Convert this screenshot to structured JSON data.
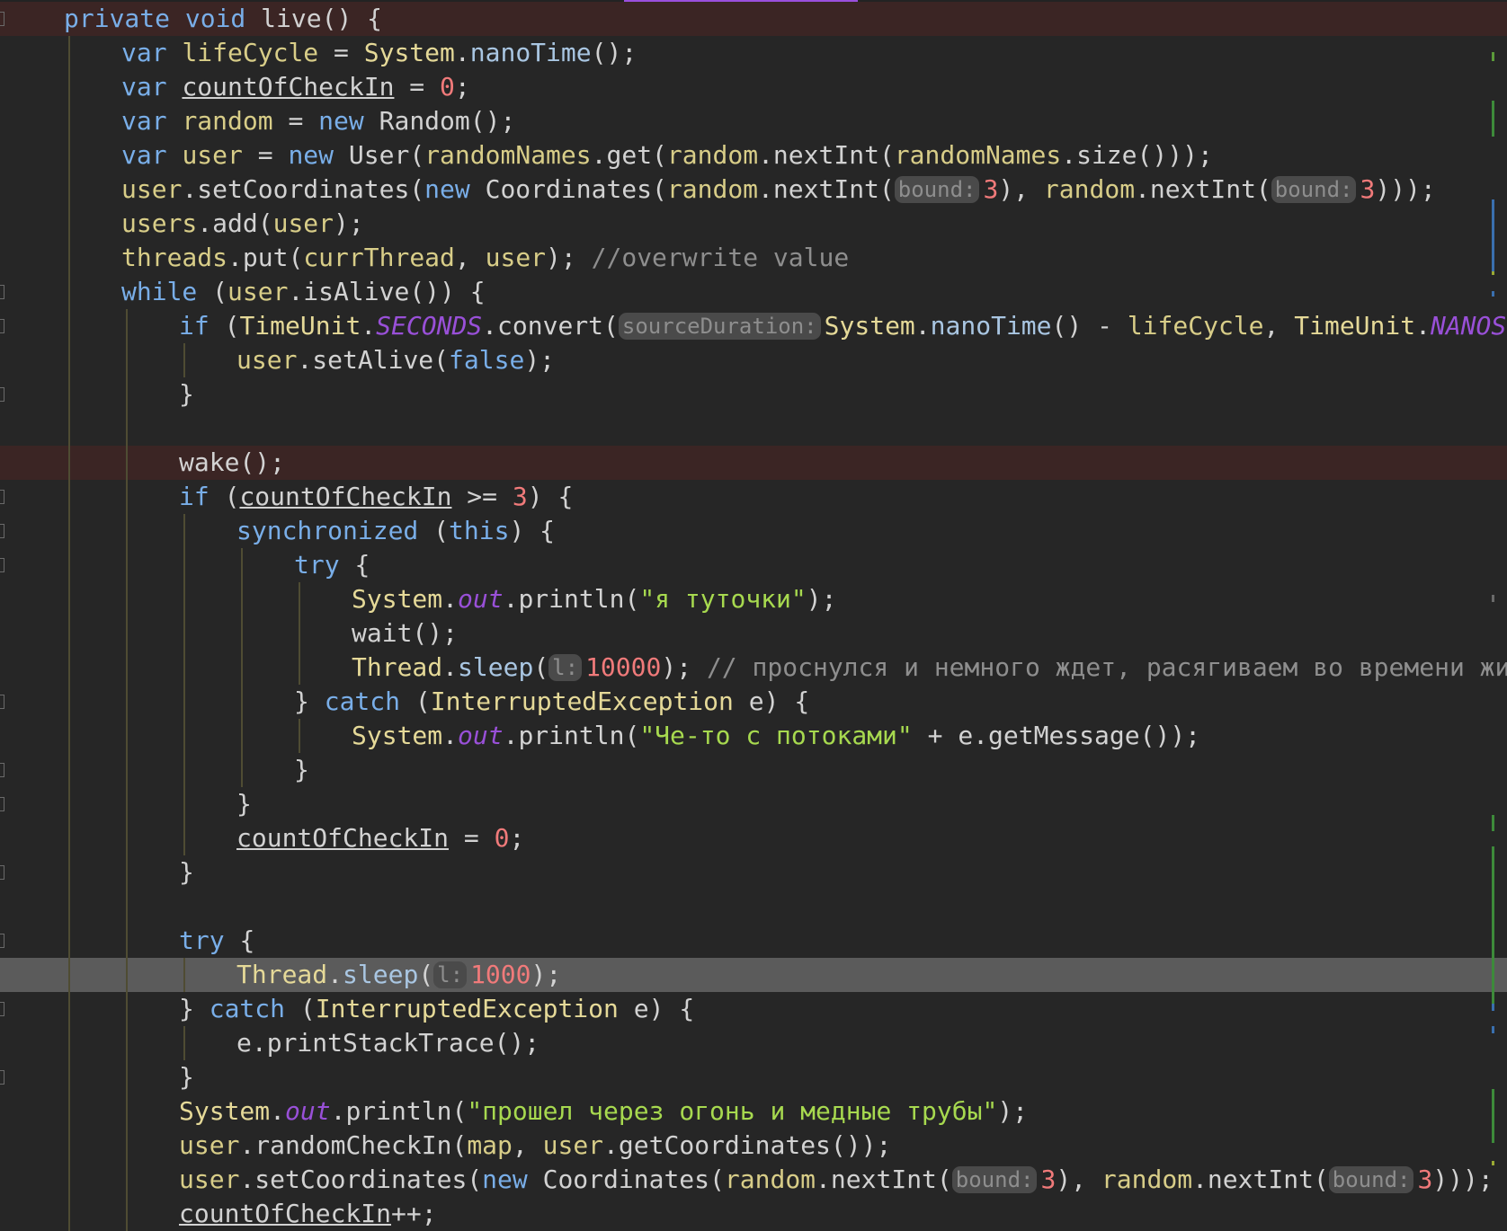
{
  "accent_colors": {
    "tab_indicator": "#9a4fdd",
    "keyword": "#79aee8",
    "class_name": "#e5d998",
    "field": "#d8cd88",
    "method": "#a9c6e2",
    "number": "#f07a7a",
    "string": "#a7d94f",
    "comment": "#8e8e8e",
    "static_field": "#9950d8",
    "breakpoint_line_bg": "#3b2524",
    "current_line_bg": "#5b5b5b"
  },
  "editor": {
    "language": "Java",
    "lines": [
      {
        "kind": "breakpoint",
        "tokens": [
          {
            "t": "private void ",
            "c": "kw"
          },
          {
            "t": "live() {"
          }
        ]
      },
      {
        "tokens": [
          {
            "t": "var ",
            "c": "kw"
          },
          {
            "t": "lifeCycle",
            "c": "fld"
          },
          {
            "t": " = "
          },
          {
            "t": "System",
            "c": "cls"
          },
          {
            "t": "."
          },
          {
            "t": "nanoTime",
            "c": "mth"
          },
          {
            "t": "();"
          }
        ]
      },
      {
        "tokens": [
          {
            "t": "var ",
            "c": "kw"
          },
          {
            "t": "countOfCheckIn",
            "c": "var-u"
          },
          {
            "t": " = "
          },
          {
            "t": "0",
            "c": "num"
          },
          {
            "t": ";"
          }
        ]
      },
      {
        "tokens": [
          {
            "t": "var ",
            "c": "kw"
          },
          {
            "t": "random",
            "c": "fld"
          },
          {
            "t": " = "
          },
          {
            "t": "new ",
            "c": "kw"
          },
          {
            "t": "Random();"
          }
        ]
      },
      {
        "tokens": [
          {
            "t": "var ",
            "c": "kw"
          },
          {
            "t": "user",
            "c": "fld"
          },
          {
            "t": " = "
          },
          {
            "t": "new ",
            "c": "kw"
          },
          {
            "t": "User("
          },
          {
            "t": "randomNames",
            "c": "fld"
          },
          {
            "t": ".get("
          },
          {
            "t": "random",
            "c": "fld"
          },
          {
            "t": ".nextInt("
          },
          {
            "t": "randomNames",
            "c": "fld"
          },
          {
            "t": ".size()));"
          }
        ]
      },
      {
        "tokens": [
          {
            "t": "user",
            "c": "fld"
          },
          {
            "t": ".setCoordinates("
          },
          {
            "t": "new ",
            "c": "kw"
          },
          {
            "t": "Coordinates("
          },
          {
            "t": "random",
            "c": "fld"
          },
          {
            "t": ".nextInt("
          },
          {
            "t": "bound:",
            "c": "hint"
          },
          {
            "t": "3",
            "c": "num"
          },
          {
            "t": "), "
          },
          {
            "t": "random",
            "c": "fld"
          },
          {
            "t": ".nextInt("
          },
          {
            "t": "bound:",
            "c": "hint"
          },
          {
            "t": "3",
            "c": "num"
          },
          {
            "t": ")));"
          }
        ]
      },
      {
        "tokens": [
          {
            "t": "users",
            "c": "fld"
          },
          {
            "t": ".add("
          },
          {
            "t": "user",
            "c": "fld"
          },
          {
            "t": ");"
          }
        ]
      },
      {
        "tokens": [
          {
            "t": "threads",
            "c": "fld"
          },
          {
            "t": ".put("
          },
          {
            "t": "currThread",
            "c": "fld"
          },
          {
            "t": ", "
          },
          {
            "t": "user",
            "c": "fld"
          },
          {
            "t": "); "
          },
          {
            "t": "//overwrite value",
            "c": "cmt"
          }
        ]
      },
      {
        "tokens": [
          {
            "t": "while ",
            "c": "kw"
          },
          {
            "t": "("
          },
          {
            "t": "user",
            "c": "fld"
          },
          {
            "t": ".isAlive()) {"
          }
        ]
      },
      {
        "tokens": [
          {
            "t": "if ",
            "c": "kw"
          },
          {
            "t": "("
          },
          {
            "t": "TimeUnit",
            "c": "cls"
          },
          {
            "t": "."
          },
          {
            "t": "SECONDS",
            "c": "stat"
          },
          {
            "t": ".convert("
          },
          {
            "t": "sourceDuration:",
            "c": "hint"
          },
          {
            "t": "System",
            "c": "cls"
          },
          {
            "t": "."
          },
          {
            "t": "nanoTime",
            "c": "mth"
          },
          {
            "t": "() - "
          },
          {
            "t": "lifeCycle",
            "c": "fld"
          },
          {
            "t": ", "
          },
          {
            "t": "TimeUnit",
            "c": "cls"
          },
          {
            "t": "."
          },
          {
            "t": "NANOSECON",
            "c": "stat"
          }
        ]
      },
      {
        "tokens": [
          {
            "t": "user",
            "c": "fld"
          },
          {
            "t": ".setAlive("
          },
          {
            "t": "false",
            "c": "kw"
          },
          {
            "t": ");"
          }
        ]
      },
      {
        "tokens": [
          {
            "t": "}"
          }
        ]
      },
      {
        "tokens": []
      },
      {
        "kind": "breakpoint",
        "tokens": [
          {
            "t": "wake();"
          }
        ]
      },
      {
        "tokens": [
          {
            "t": "if ",
            "c": "kw"
          },
          {
            "t": "("
          },
          {
            "t": "countOfCheckIn",
            "c": "var-u"
          },
          {
            "t": " >= "
          },
          {
            "t": "3",
            "c": "num"
          },
          {
            "t": ") {"
          }
        ]
      },
      {
        "tokens": [
          {
            "t": "synchronized ",
            "c": "kw"
          },
          {
            "t": "("
          },
          {
            "t": "this",
            "c": "kw"
          },
          {
            "t": ") {"
          }
        ]
      },
      {
        "tokens": [
          {
            "t": "try ",
            "c": "kw"
          },
          {
            "t": "{"
          }
        ]
      },
      {
        "tokens": [
          {
            "t": "System",
            "c": "cls"
          },
          {
            "t": "."
          },
          {
            "t": "out",
            "c": "stat"
          },
          {
            "t": ".println("
          },
          {
            "t": "\"я туточки\"",
            "c": "str"
          },
          {
            "t": ");"
          }
        ]
      },
      {
        "tokens": [
          {
            "t": "wait();"
          }
        ]
      },
      {
        "tokens": [
          {
            "t": "Thread",
            "c": "cls"
          },
          {
            "t": "."
          },
          {
            "t": "sleep",
            "c": "mth"
          },
          {
            "t": "("
          },
          {
            "t": "l:",
            "c": "hint"
          },
          {
            "t": "10000",
            "c": "num"
          },
          {
            "t": "); "
          },
          {
            "t": "// проснулся и немного ждет, расягиваем во времени жизнь",
            "c": "cmt"
          }
        ]
      },
      {
        "tokens": [
          {
            "t": "} "
          },
          {
            "t": "catch ",
            "c": "kw"
          },
          {
            "t": "("
          },
          {
            "t": "InterruptedException",
            "c": "cls"
          },
          {
            "t": " e) {"
          }
        ]
      },
      {
        "tokens": [
          {
            "t": "System",
            "c": "cls"
          },
          {
            "t": "."
          },
          {
            "t": "out",
            "c": "stat"
          },
          {
            "t": ".println("
          },
          {
            "t": "\"Че-то с потоками\"",
            "c": "str"
          },
          {
            "t": " + e.getMessage());"
          }
        ]
      },
      {
        "tokens": [
          {
            "t": "}"
          }
        ]
      },
      {
        "tokens": [
          {
            "t": "}"
          }
        ]
      },
      {
        "tokens": [
          {
            "t": "countOfCheckIn",
            "c": "var-u"
          },
          {
            "t": " = "
          },
          {
            "t": "0",
            "c": "num"
          },
          {
            "t": ";"
          }
        ]
      },
      {
        "tokens": [
          {
            "t": "}"
          }
        ]
      },
      {
        "tokens": []
      },
      {
        "tokens": [
          {
            "t": "try ",
            "c": "kw"
          },
          {
            "t": "{"
          }
        ]
      },
      {
        "kind": "current",
        "tokens": [
          {
            "t": "Thread",
            "c": "cls"
          },
          {
            "t": "."
          },
          {
            "t": "sleep",
            "c": "mth"
          },
          {
            "t": "("
          },
          {
            "t": "l:",
            "c": "hint"
          },
          {
            "t": "1000",
            "c": "num"
          },
          {
            "t": ");"
          }
        ]
      },
      {
        "tokens": [
          {
            "t": "} "
          },
          {
            "t": "catch ",
            "c": "kw"
          },
          {
            "t": "("
          },
          {
            "t": "InterruptedException",
            "c": "cls"
          },
          {
            "t": " e) {"
          }
        ]
      },
      {
        "tokens": [
          {
            "t": "e.printStackTrace();"
          }
        ]
      },
      {
        "tokens": [
          {
            "t": "}"
          }
        ]
      },
      {
        "tokens": [
          {
            "t": "System",
            "c": "cls"
          },
          {
            "t": "."
          },
          {
            "t": "out",
            "c": "stat"
          },
          {
            "t": ".println("
          },
          {
            "t": "\"прошел через огонь и медные трубы\"",
            "c": "str"
          },
          {
            "t": ");"
          }
        ]
      },
      {
        "tokens": [
          {
            "t": "user",
            "c": "fld"
          },
          {
            "t": ".randomCheckIn("
          },
          {
            "t": "map",
            "c": "fld"
          },
          {
            "t": ", "
          },
          {
            "t": "user",
            "c": "fld"
          },
          {
            "t": ".getCoordinates());"
          }
        ]
      },
      {
        "tokens": [
          {
            "t": "user",
            "c": "fld"
          },
          {
            "t": ".setCoordinates("
          },
          {
            "t": "new ",
            "c": "kw"
          },
          {
            "t": "Coordinates("
          },
          {
            "t": "random",
            "c": "fld"
          },
          {
            "t": ".nextInt("
          },
          {
            "t": "bound:",
            "c": "hint"
          },
          {
            "t": "3",
            "c": "num"
          },
          {
            "t": "), "
          },
          {
            "t": "random",
            "c": "fld"
          },
          {
            "t": ".nextInt("
          },
          {
            "t": "bound:",
            "c": "hint"
          },
          {
            "t": "3",
            "c": "num"
          },
          {
            "t": ")));"
          }
        ]
      },
      {
        "tokens": [
          {
            "t": "countOfCheckIn",
            "c": "var-u"
          },
          {
            "t": "++;"
          }
        ]
      }
    ]
  }
}
